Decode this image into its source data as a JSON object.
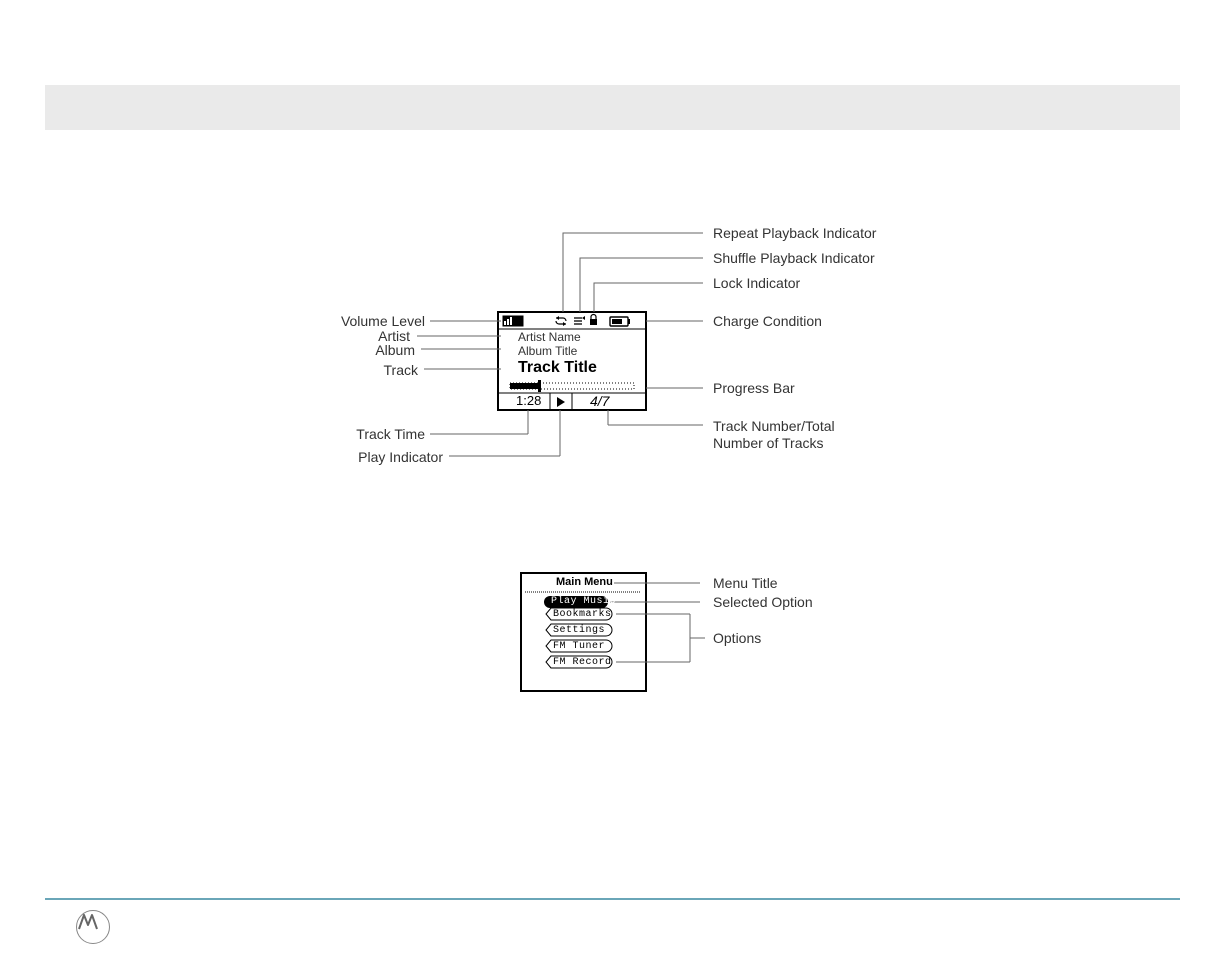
{
  "play_diagram": {
    "left_labels": {
      "volume_level": "Volume Level",
      "artist": "Artist",
      "album": "Album",
      "track": "Track",
      "track_time": "Track Time",
      "play_indicator": "Play Indicator"
    },
    "right_labels": {
      "repeat": "Repeat Playback Indicator",
      "shuffle": "Shuffle Playback Indicator",
      "lock": "Lock Indicator",
      "charge": "Charge Condition",
      "progress_bar": "Progress Bar",
      "track_number": "Track Number/Total",
      "track_number2": "Number of Tracks"
    },
    "screen": {
      "artist_name": "Artist Name",
      "album_title": "Album Title",
      "track_title": "Track Title",
      "track_time": "1:28",
      "track_count": "4/7"
    }
  },
  "menu_diagram": {
    "screen": {
      "title": "Main Menu",
      "items": [
        "Play Music",
        "Bookmarks",
        "Settings",
        "FM Tuner",
        "FM Record"
      ]
    },
    "labels": {
      "menu_title": "Menu Title",
      "selected_option": "Selected Option",
      "options": "Options"
    }
  }
}
